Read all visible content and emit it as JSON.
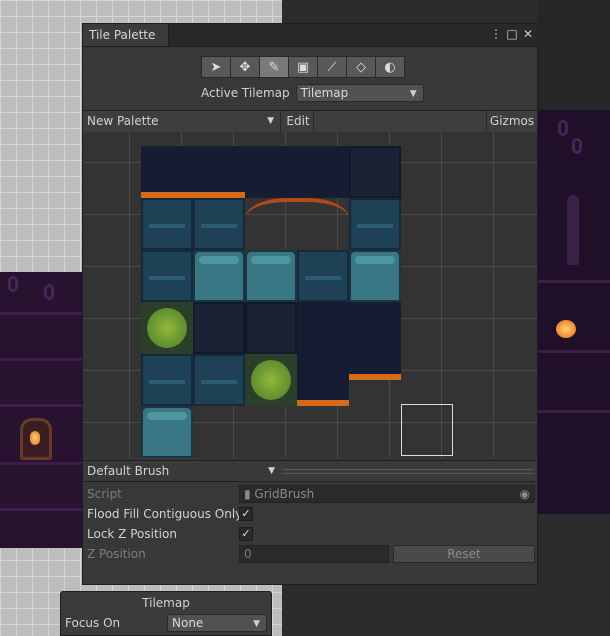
{
  "tile_palette": {
    "title": "Tile Palette",
    "controls": {
      "menu": "⋮",
      "maximize": "□",
      "close": "✕"
    },
    "tools": [
      {
        "icon": "select-icon",
        "glyph": "➤"
      },
      {
        "icon": "move-icon",
        "glyph": "✥"
      },
      {
        "icon": "paint-brush-icon",
        "glyph": "✎"
      },
      {
        "icon": "box-fill-icon",
        "glyph": "▣"
      },
      {
        "icon": "picker-icon",
        "glyph": "⟋"
      },
      {
        "icon": "eraser-icon",
        "glyph": "◇"
      },
      {
        "icon": "fill-bucket-icon",
        "glyph": "◐"
      }
    ],
    "active_tilemap_label": "Active Tilemap",
    "active_tilemap_value": "Tilemap",
    "palette_name": "New Palette",
    "edit_label": "Edit",
    "gizmos_label": "Gizmos",
    "brush_name": "Default Brush",
    "script_label": "Script",
    "script_value": "GridBrush",
    "flood_fill_label": "Flood Fill Contiguous Only",
    "flood_fill_checked": "✓",
    "lock_z_label": "Lock Z Position",
    "lock_z_checked": "✓",
    "z_position_label": "Z Position",
    "z_position_value": "0",
    "reset_label": "Reset"
  },
  "overlay": {
    "title": "Tilemap",
    "focus_label": "Focus On",
    "focus_value": "None"
  },
  "colors": {
    "panel": "#383838",
    "stone": "#1e4156",
    "trim_orange": "#d66a1c",
    "moss": "#92b83a",
    "dungeon_purple": "#27122f"
  }
}
